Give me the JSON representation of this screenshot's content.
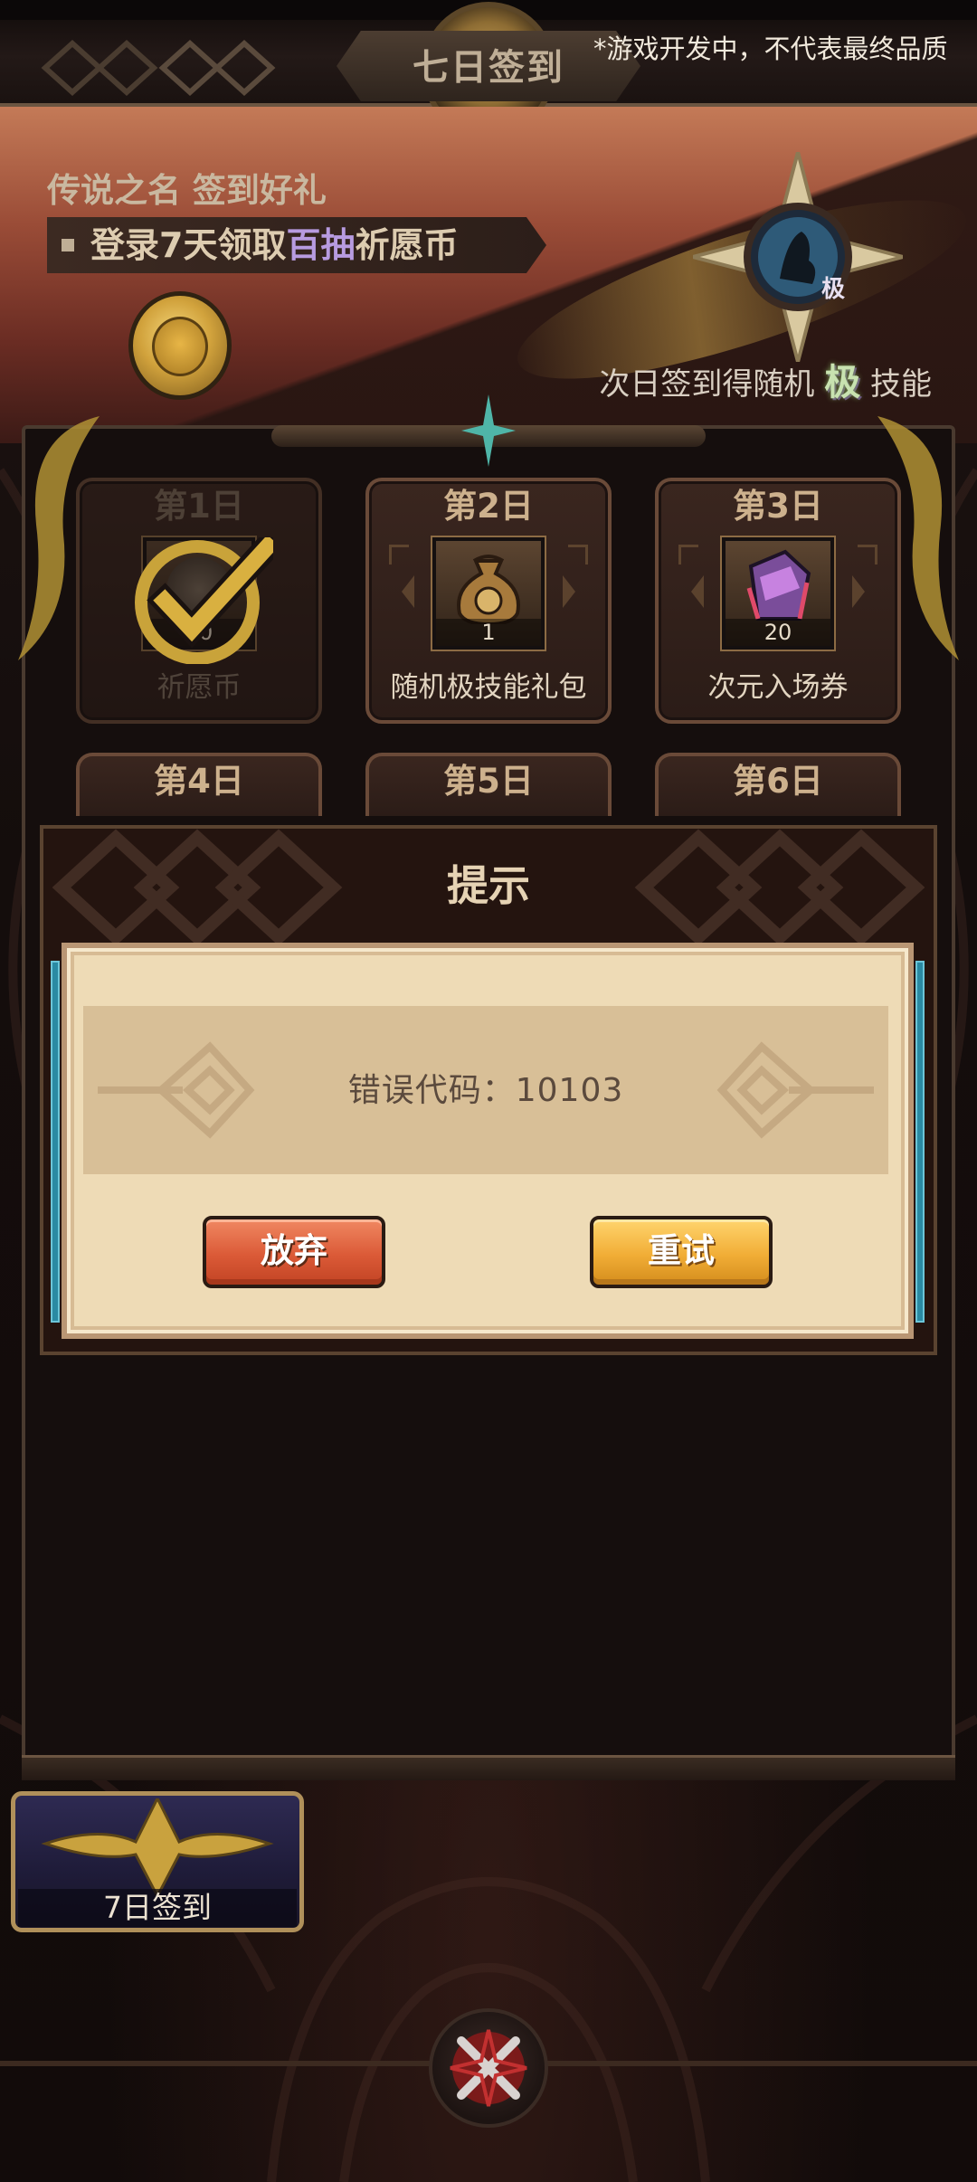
{
  "header": {
    "title": "七日签到",
    "dev_note": "*游戏开发中，不代表最终品质"
  },
  "banner": {
    "subtitle": "传说之名 签到好礼",
    "strip_prefix": "登录7天领取",
    "strip_highlight": "百抽",
    "strip_suffix": "祈愿币",
    "emblem_badge": "极",
    "caption_prefix": "次日签到得随机",
    "caption_mark": "极",
    "caption_suffix": "技能"
  },
  "days": [
    {
      "title": "第1日",
      "label": "祈愿币",
      "count": "10",
      "claimed": true,
      "icon": "coin-icon"
    },
    {
      "title": "第2日",
      "label": "随机极技能礼包",
      "count": "1",
      "claimed": false,
      "icon": "pouch-icon"
    },
    {
      "title": "第3日",
      "label": "次元入场券",
      "count": "20",
      "claimed": false,
      "icon": "ticket-icon"
    },
    {
      "title": "第4日"
    },
    {
      "title": "第5日"
    },
    {
      "title": "第6日"
    }
  ],
  "dialog": {
    "title": "提示",
    "message": "错误代码：10103",
    "abandon_label": "放弃",
    "retry_label": "重试"
  },
  "bottom": {
    "sevenday_label": "7日签到"
  },
  "colors": {
    "accent_gold": "#c9a35a",
    "abandon_red": "#db5a37",
    "retry_orange": "#f1ad36",
    "dialog_paper": "#eedbb6"
  }
}
